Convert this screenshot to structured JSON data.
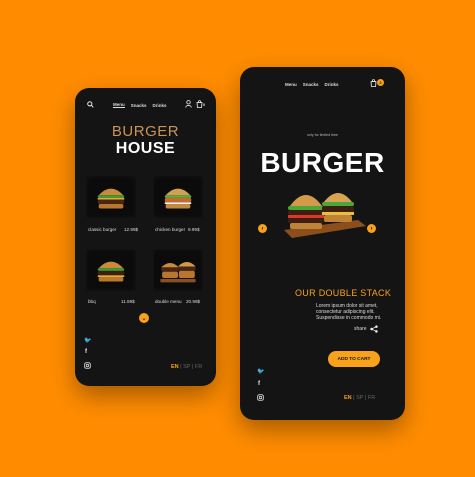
{
  "left_phone": {
    "nav": [
      "Menu",
      "Snacks",
      "Drinks"
    ],
    "cart_count": "0",
    "brand_line1": "BURGER",
    "brand_line2": "HOUSE",
    "items": [
      {
        "name": "classic burger",
        "price": "12.99$"
      },
      {
        "name": "chicken burger",
        "price": "9.99$"
      },
      {
        "name": "bbq",
        "price": "11.99$"
      },
      {
        "name": "double menu",
        "price": "20.99$"
      }
    ],
    "scroll_down": "⌄",
    "lang": {
      "active": "EN",
      "sep": "|",
      "others": "SP | FR"
    }
  },
  "right_phone": {
    "nav": [
      "Menu",
      "Snacks",
      "Drinks"
    ],
    "cart_count": "2",
    "tagline": "only for limited time",
    "title": "BURGER",
    "subtitle": "OUR DOUBLE STACK",
    "description": "Lorem ipsum dolor sit amet, consectetur adipiscing elit. Suspendisse in commodo mi.",
    "share_label": "share",
    "add_to_cart": "ADD TO CART",
    "prev": "‹",
    "next": "›",
    "lang": {
      "active": "EN",
      "sep": "|",
      "others": "SP | FR"
    }
  },
  "colors": {
    "background": "#ff8c00",
    "accent": "#f7a21a",
    "phone": "#141414",
    "brand": "#c9945a"
  }
}
